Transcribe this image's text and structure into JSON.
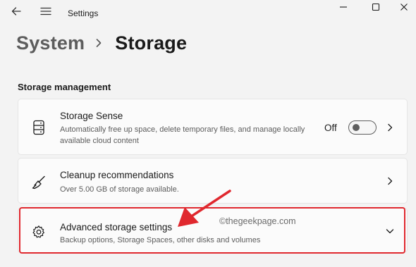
{
  "window": {
    "title": "Settings",
    "controls": [
      "minimize-icon",
      "maximize-icon",
      "close-icon"
    ],
    "nav_icons": [
      "back-arrow-icon",
      "hamburger-menu-icon"
    ]
  },
  "breadcrumb": {
    "parent": "System",
    "separator_icon": "chevron-right-icon",
    "current": "Storage"
  },
  "storage_management": {
    "title": "Storage management",
    "items": [
      {
        "icon": "storage-drive-icon",
        "title": "Storage Sense",
        "description": "Automatically free up space, delete temporary files, and manage locally available cloud content",
        "toggle_label": "Off",
        "toggle_on": false,
        "action_icon": "chevron-right-icon"
      },
      {
        "icon": "broom-icon",
        "title": "Cleanup recommendations",
        "description": "Over 5.00 GB of storage available.",
        "action_icon": "chevron-right-icon"
      },
      {
        "icon": "gear-icon",
        "title": "Advanced storage settings",
        "description": "Backup options, Storage Spaces, other disks and volumes",
        "action_icon": "chevron-down-icon"
      }
    ]
  },
  "annotation": {
    "watermark": "©thegeekpage.com",
    "highlight_color": "#e0282e",
    "arrow_color": "#e0282e"
  },
  "colors": {
    "background": "#f3f3f3",
    "card": "#fbfbfb",
    "text": "#1a1a1a",
    "muted": "#5c5c5c"
  }
}
